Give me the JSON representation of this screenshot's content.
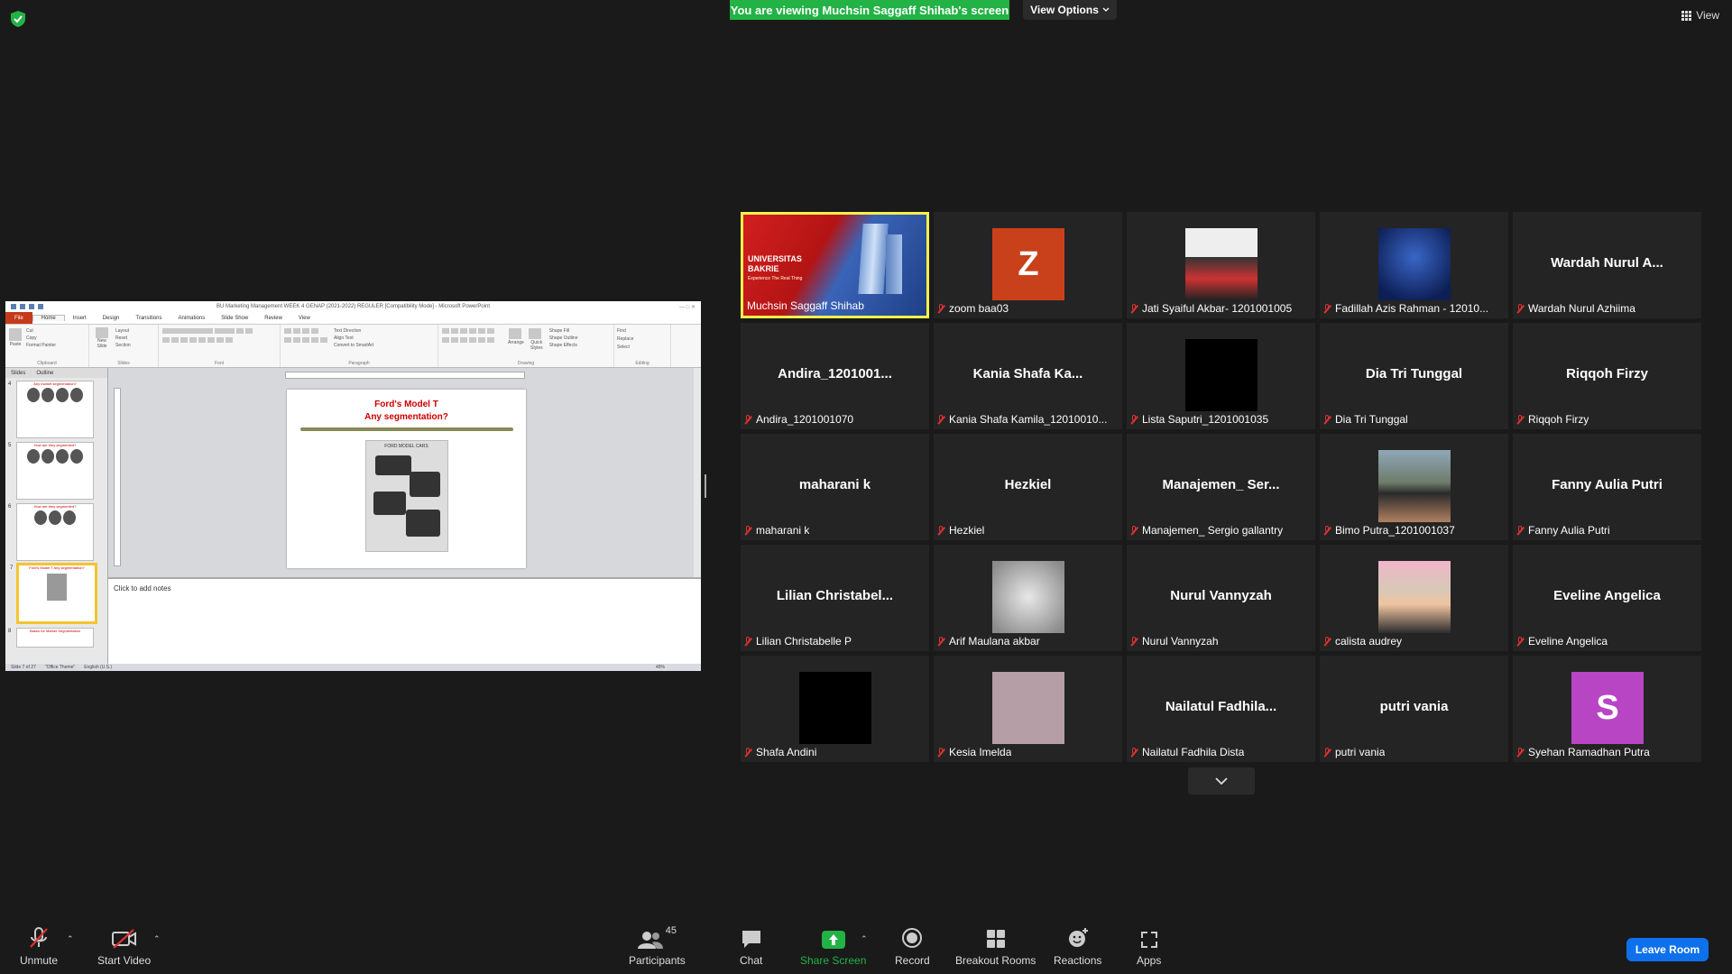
{
  "banner": {
    "text": "You are viewing Muchsin Saggaff Shihab's screen",
    "view_options": "View Options"
  },
  "top_right": {
    "view_label": "View"
  },
  "colors": {
    "banner_green": "#23b245",
    "active_speaker": "#f8f04a",
    "leave_blue": "#0e71eb",
    "mic_muted": "#e03131"
  },
  "shared_screen": {
    "window_title": "BU Marketing Management WEEK 4 GENAP (2021-2022) REGULER [Compatibility Mode] - Microsoft PowerPoint",
    "ribbon_tabs": [
      "File",
      "Home",
      "Insert",
      "Design",
      "Transitions",
      "Animations",
      "Slide Show",
      "Review",
      "View"
    ],
    "ribbon_groups": [
      "Clipboard",
      "Slides",
      "Font",
      "Paragraph",
      "Drawing",
      "Editing"
    ],
    "ribbon_items": {
      "paste": "Paste",
      "cut": "Cut",
      "copy": "Copy",
      "format_painter": "Format Painter",
      "new_slide": "New Slide",
      "layout": "Layout",
      "reset": "Reset",
      "section": "Section",
      "text_direction": "Text Direction",
      "align_text": "Align Text",
      "convert_smartart": "Convert to SmartArt",
      "arrange": "Arrange",
      "quick_styles": "Quick Styles",
      "shape_fill": "Shape Fill",
      "shape_outline": "Shape Outline",
      "shape_effects": "Shape Effects",
      "find": "Find",
      "replace": "Replace",
      "select": "Select"
    },
    "panel_tabs": [
      "Slides",
      "Outline"
    ],
    "thumbnails": [
      {
        "num": "4",
        "title": "Any market segmentation?"
      },
      {
        "num": "5",
        "title": "How are they segmented?"
      },
      {
        "num": "6",
        "title": "How are they segmented?"
      },
      {
        "num": "7",
        "title": "Ford's Model T Any segmentation?"
      },
      {
        "num": "8",
        "title": "Bases for Market Segmentation"
      }
    ],
    "slide": {
      "line1": "Ford's Model T",
      "line2": "Any segmentation?",
      "image_caption": "FORD MODEL CARS"
    },
    "notes_placeholder": "Click to add notes",
    "status": {
      "slide_count": "Slide 7 of 27",
      "theme": "\"Office Theme\"",
      "language": "English (U.S.)",
      "zoom": "49%"
    }
  },
  "participants_tiles": [
    {
      "name": "Muchsin Saggaff Shihab",
      "type": "video",
      "active": true,
      "muted": false
    },
    {
      "name": "zoom baa03",
      "type": "letter",
      "letter": "Z",
      "color": "#c9411b",
      "muted": true
    },
    {
      "name": "Jati Syaiful Akbar- 1201001005",
      "type": "photo",
      "photo": "person",
      "muted": true
    },
    {
      "name": "Fadillah Azis Rahman - 12010...",
      "type": "photo",
      "photo": "blue-blur",
      "muted": true
    },
    {
      "name": "Wardah Nurul Azhiima",
      "type": "name",
      "display": "Wardah  Nurul  A...",
      "muted": true
    },
    {
      "name": "Andira_1201001070",
      "type": "name",
      "display": "Andira_1201001...",
      "muted": true
    },
    {
      "name": "Kania Shafa Kamila_12010010...",
      "type": "name",
      "display": "Kania  Shafa  Ka...",
      "muted": true
    },
    {
      "name": "Lista Saputri_1201001035",
      "type": "photo",
      "photo": "black",
      "muted": true
    },
    {
      "name": "Dia Tri Tunggal",
      "type": "name",
      "display": "Dia Tri Tunggal",
      "muted": true
    },
    {
      "name": "Riqqoh Firzy",
      "type": "name",
      "display": "Riqqoh Firzy",
      "muted": true
    },
    {
      "name": "maharani k",
      "type": "name",
      "display": "maharani k",
      "muted": true
    },
    {
      "name": "Hezkiel",
      "type": "name",
      "display": "Hezkiel",
      "muted": true
    },
    {
      "name": "Manajemen_ Sergio gallantry",
      "type": "name",
      "display": "Manajemen_  Ser...",
      "muted": true
    },
    {
      "name": "Bimo Putra_1201001037",
      "type": "photo",
      "photo": "outdoor",
      "muted": true
    },
    {
      "name": "Fanny Aulia Putri",
      "type": "name",
      "display": "Fanny Aulia Putri",
      "muted": true
    },
    {
      "name": "Lilian Christabelle P",
      "type": "name",
      "display": "Lilian  Christabel...",
      "muted": true
    },
    {
      "name": "Arif Maulana akbar",
      "type": "photo",
      "photo": "grey-blur",
      "muted": true
    },
    {
      "name": "Nurul Vannyzah",
      "type": "name",
      "display": "Nurul Vannyzah",
      "muted": true
    },
    {
      "name": "calista audrey",
      "type": "photo",
      "photo": "hijab",
      "muted": true
    },
    {
      "name": "Eveline Angelica",
      "type": "name",
      "display": "Eveline Angelica",
      "muted": true
    },
    {
      "name": "Shafa Andini",
      "type": "photo",
      "photo": "black",
      "muted": true
    },
    {
      "name": "Kesia Imelda",
      "type": "photo",
      "photo": "mauve",
      "muted": true
    },
    {
      "name": "Nailatul Fadhila Dista",
      "type": "name",
      "display": "Nailatul  Fadhila...",
      "muted": true
    },
    {
      "name": "putri vania",
      "type": "name",
      "display": "putri vania",
      "muted": true
    },
    {
      "name": "Syehan Ramadhan Putra",
      "type": "letter",
      "letter": "S",
      "color": "#b845c4",
      "muted": true
    }
  ],
  "active_tile_content": {
    "line1": "UNIVERSITAS",
    "line2": "BAKRIE",
    "tagline": "Experience The Real Thing"
  },
  "toolbar": {
    "unmute": "Unmute",
    "start_video": "Start Video",
    "participants": "Participants",
    "participants_count": "45",
    "chat": "Chat",
    "share_screen": "Share Screen",
    "record": "Record",
    "breakout_rooms": "Breakout Rooms",
    "reactions": "Reactions",
    "apps": "Apps",
    "leave": "Leave Room"
  }
}
